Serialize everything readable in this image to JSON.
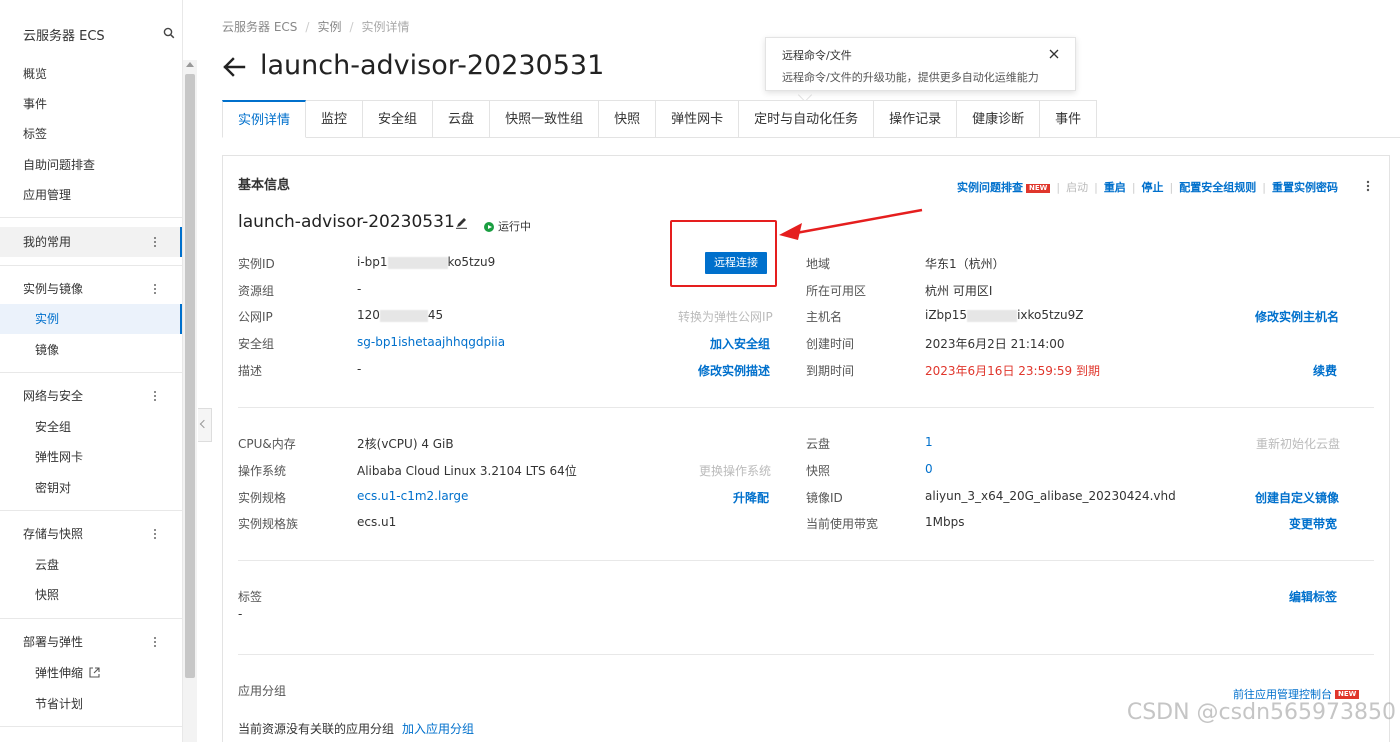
{
  "sidebar": {
    "title": "云服务器 ECS",
    "items": {
      "overview": "概览",
      "events": "事件",
      "tags": "标签",
      "troubleshoot": "自助问题排查",
      "app_mgmt": "应用管理",
      "favorites": "我的常用",
      "instances_images": "实例与镜像",
      "instances": "实例",
      "images": "镜像",
      "network_security": "网络与安全",
      "security_groups": "安全组",
      "eni": "弹性网卡",
      "keypairs": "密钥对",
      "storage_snapshots": "存储与快照",
      "disks": "云盘",
      "snapshots": "快照",
      "deploy_elastic": "部署与弹性",
      "auto_scaling": "弹性伸缩",
      "savings_plan": "节省计划"
    }
  },
  "breadcrumb": {
    "root": "云服务器 ECS",
    "parent": "实例",
    "current": "实例详情"
  },
  "page_title": "launch-advisor-20230531",
  "tooltip": {
    "title": "远程命令/文件",
    "text": "远程命令/文件的升级功能，提供更多自动化运维能力"
  },
  "tabs": [
    "实例详情",
    "监控",
    "安全组",
    "云盘",
    "快照一致性组",
    "快照",
    "弹性网卡",
    "定时与自动化任务",
    "操作记录",
    "健康诊断",
    "事件"
  ],
  "basic": {
    "section_title": "基本信息",
    "actions": {
      "troubleshoot": "实例问题排查",
      "new_badge": "NEW",
      "start": "启动",
      "restart": "重启",
      "stop": "停止",
      "config_sg": "配置安全组规则",
      "reset_pwd": "重置实例密码"
    },
    "instance_name": "launch-advisor-20230531",
    "status": "运行中",
    "remote_connect": "远程连接",
    "left": {
      "instance_id_label": "实例ID",
      "instance_id_prefix": "i-bp1",
      "instance_id_suffix": "ko5tzu9",
      "resource_group_label": "资源组",
      "resource_group_value": "-",
      "public_ip_label": "公网IP",
      "public_ip_prefix": "120",
      "public_ip_suffix": "45",
      "convert_eip": "转换为弹性公网IP",
      "security_group_label": "安全组",
      "security_group_value": "sg-bp1ishetaajhhqgdpiia",
      "join_sg": "加入安全组",
      "desc_label": "描述",
      "desc_value": "-",
      "edit_desc": "修改实例描述"
    },
    "right": {
      "region_label": "地域",
      "region_value": "华东1（杭州）",
      "zone_label": "所在可用区",
      "zone_value": "杭州 可用区I",
      "hostname_label": "主机名",
      "hostname_prefix": "iZbp15",
      "hostname_suffix": "ixko5tzu9Z",
      "edit_hostname": "修改实例主机名",
      "created_label": "创建时间",
      "created_value": "2023年6月2日 21:14:00",
      "expire_label": "到期时间",
      "expire_value": "2023年6月16日 23:59:59 到期",
      "renew": "续费"
    }
  },
  "config": {
    "cpu_label": "CPU&内存",
    "cpu_value": "2核(vCPU) 4 GiB",
    "os_label": "操作系统",
    "os_value": "Alibaba Cloud Linux 3.2104 LTS 64位",
    "change_os": "更换操作系统",
    "spec_label": "实例规格",
    "spec_value": "ecs.u1-c1m2.large",
    "upgrade": "升降配",
    "family_label": "实例规格族",
    "family_value": "ecs.u1",
    "disk_label": "云盘",
    "disk_value": "1",
    "reinit_disk": "重新初始化云盘",
    "snapshot_label": "快照",
    "snapshot_value": "0",
    "image_label": "镜像ID",
    "image_value": "aliyun_3_x64_20G_alibase_20230424.vhd",
    "create_image": "创建自定义镜像",
    "bandwidth_label": "当前使用带宽",
    "bandwidth_value": "1Mbps",
    "change_bandwidth": "变更带宽"
  },
  "tags": {
    "label": "标签",
    "value": "-",
    "edit": "编辑标签"
  },
  "app_group": {
    "label": "应用分组",
    "goto": "前往应用管理控制台",
    "new_badge": "NEW",
    "empty_text": "当前资源没有关联的应用分组",
    "add": "加入应用分组"
  },
  "watermark": "CSDN @csdn565973850",
  "colors": {
    "accent": "#0070cc",
    "status_green": "#1a9e41",
    "danger": "#e0362c",
    "annotation": "#e51e1e"
  }
}
